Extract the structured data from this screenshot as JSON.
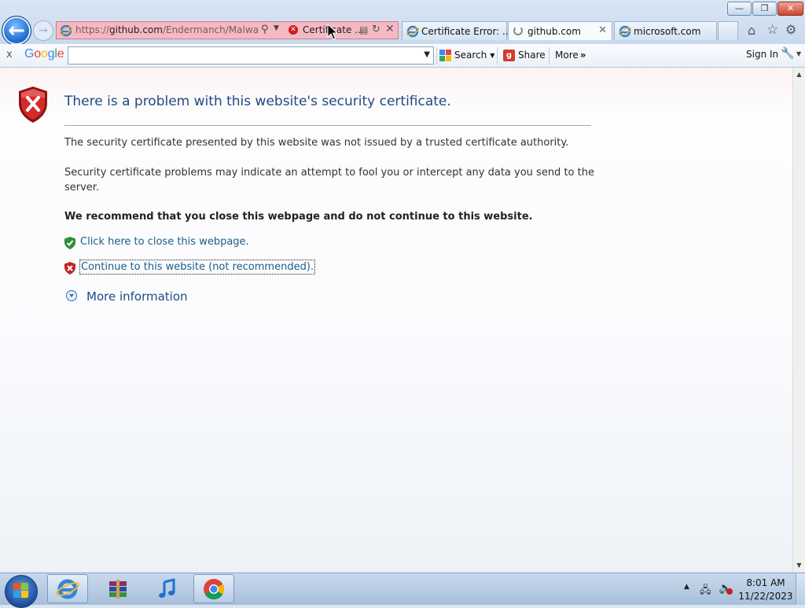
{
  "browser": {
    "address": {
      "url_prefix": "https://",
      "url_domain": "github.com",
      "url_rest": "/Endermanch/MalwareD",
      "cert_error_label": "Certificate ..."
    },
    "tabs": [
      {
        "label": "Certificate Error: ..."
      },
      {
        "label": "github.com"
      },
      {
        "label": "microsoft.com"
      }
    ]
  },
  "toolbar": {
    "close": "x",
    "logo_letters": [
      "G",
      "o",
      "o",
      "g",
      "l",
      "e"
    ],
    "search_value": "",
    "search_label": "Search",
    "share_label": "Share",
    "more_label": "More",
    "signin_label": "Sign In"
  },
  "page": {
    "heading": "There is a problem with this website's security certificate.",
    "paragraph1": "The security certificate presented by this website was not issued by a trusted certificate authority.",
    "paragraph2": "Security certificate problems may indicate an attempt to fool you or intercept any data you send to the server.",
    "recommend": "We recommend that you close this webpage and do not continue to this website.",
    "close_link": "Click here to close this webpage.",
    "continue_link": "Continue to this website (not recommended).",
    "more_info": "More information"
  },
  "taskbar": {
    "apps": [
      "internet-explorer",
      "winrar",
      "itunes",
      "chrome"
    ],
    "time": "8:01 AM",
    "date": "11/22/2023"
  },
  "colors": {
    "address_error": "#f5b9c3",
    "link": "#1a5d87",
    "heading": "#1f4a82",
    "google_blue": "#4285f4",
    "google_red": "#ea4335",
    "google_yellow": "#fbbc05",
    "google_green": "#34a853"
  }
}
